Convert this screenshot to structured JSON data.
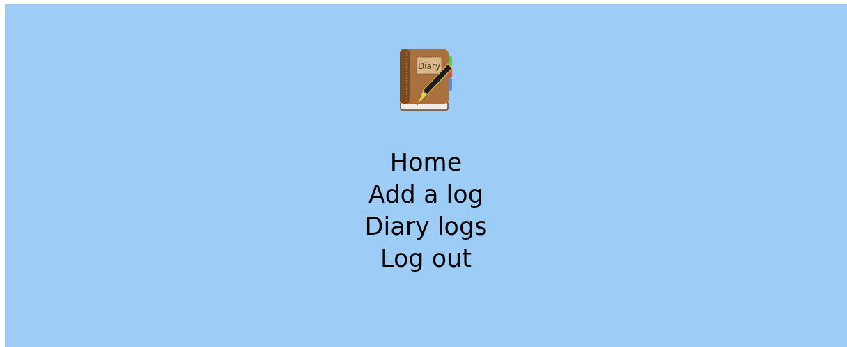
{
  "logo": {
    "label": "Diary"
  },
  "menu": [
    {
      "label": "Home"
    },
    {
      "label": "Add a log"
    },
    {
      "label": "Diary logs"
    },
    {
      "label": "Log out"
    }
  ]
}
